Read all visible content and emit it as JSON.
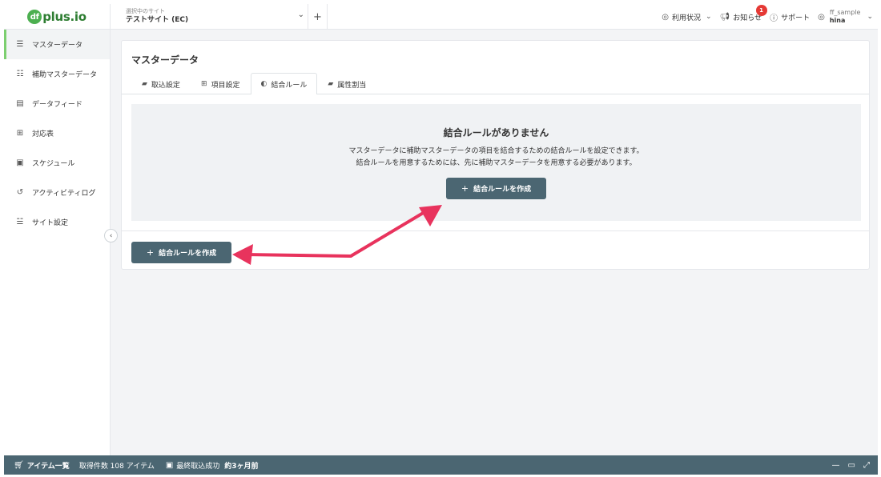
{
  "header": {
    "logo": {
      "mark": "df",
      "text": "plus.io"
    },
    "site_select": {
      "label": "選択中のサイト",
      "value": "テストサイト (EC)"
    },
    "add_site": "+",
    "usage": "利用状況",
    "notifications": "お知らせ",
    "notification_count": "1",
    "support": "サポート",
    "user": {
      "id": "ff_sample",
      "name": "hina"
    }
  },
  "sidebar": {
    "items": [
      {
        "label": "マスターデータ",
        "icon": "database-icon",
        "active": true
      },
      {
        "label": "補助マスターデータ",
        "icon": "database-add-icon"
      },
      {
        "label": "データフィード",
        "icon": "document-icon"
      },
      {
        "label": "対応表",
        "icon": "table-icon"
      },
      {
        "label": "スケジュール",
        "icon": "calendar-clock-icon"
      },
      {
        "label": "アクティビティログ",
        "icon": "history-icon"
      },
      {
        "label": "サイト設定",
        "icon": "sliders-icon"
      }
    ]
  },
  "main": {
    "title": "マスターデータ",
    "tabs": [
      {
        "label": "取込設定",
        "icon": "folder-download-icon"
      },
      {
        "label": "項目設定",
        "icon": "table-icon"
      },
      {
        "label": "結合ルール",
        "icon": "merge-icon",
        "active": true
      },
      {
        "label": "属性割当",
        "icon": "folder-icon"
      }
    ],
    "empty": {
      "title": "結合ルールがありません",
      "line1": "マスターデータに補助マスターデータの項目を結合するための結合ルールを設定できます。",
      "line2": "結合ルールを用意するためには、先に補助マスターデータを用意する必要があります。",
      "button": "結合ルールを作成"
    },
    "create_button": "結合ルールを作成"
  },
  "footer": {
    "title": "アイテム一覧",
    "count": "取得件数 108 アイテム",
    "last_label": "最終取込成功",
    "last_value": "約3ヶ月前"
  },
  "colors": {
    "accent": "#4b6672",
    "sidebar_active": "#7ccf6f",
    "badge": "#e53935",
    "arrow": "#e8335d"
  }
}
